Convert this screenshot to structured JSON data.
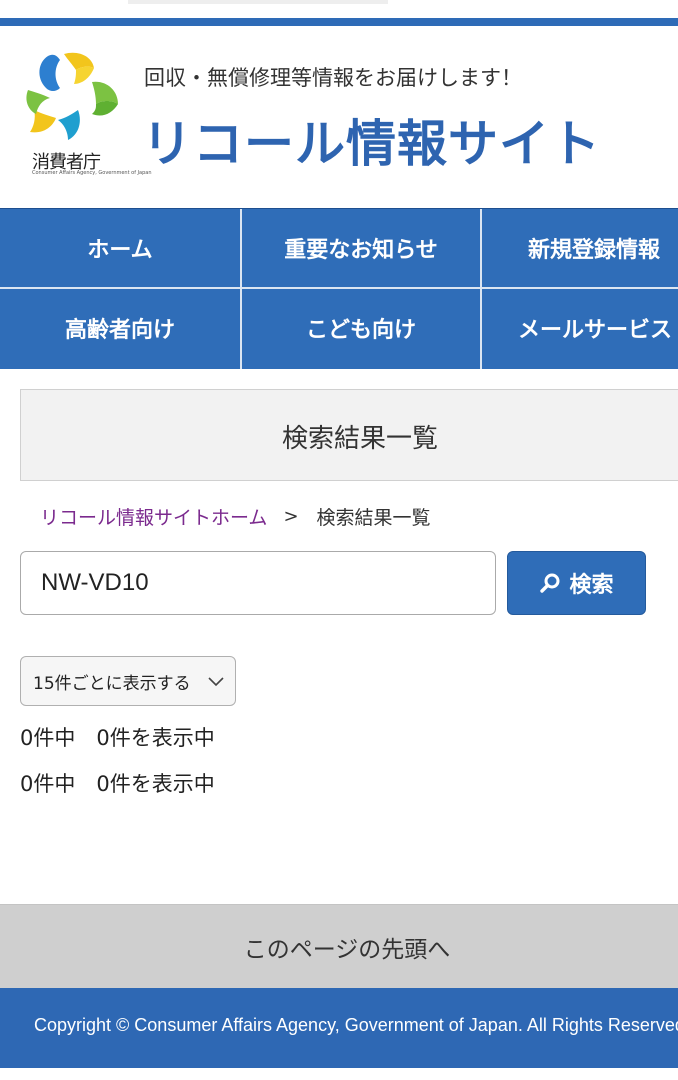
{
  "header": {
    "logo_caption": "消費者庁",
    "logo_sub": "Consumer Affairs Agency, Government of Japan",
    "tagline": "回収・無償修理等情報をお届けします！",
    "site_title": "リコール情報サイト"
  },
  "nav": {
    "items": [
      {
        "label": "ホーム"
      },
      {
        "label": "重要なお知らせ"
      },
      {
        "label": "新規登録情報"
      },
      {
        "label": "高齢者向け"
      },
      {
        "label": "こども向け"
      },
      {
        "label": "メールサービス"
      }
    ]
  },
  "page": {
    "heading": "検索結果一覧"
  },
  "breadcrumb": {
    "home": "リコール情報サイトホーム",
    "separator": ">",
    "current": "検索結果一覧"
  },
  "search": {
    "value": "NW-VD10",
    "button_label": "検索"
  },
  "results": {
    "per_page": "15件ごとに表示する",
    "count_top": "0件中　0件を表示中",
    "count_bottom": "0件中　0件を表示中"
  },
  "footer": {
    "back_to_top": "このページの先頭へ",
    "copyright": "Copyright © Consumer Affairs Agency, Government of Japan. All Rights Reserved."
  },
  "colors": {
    "primary": "#2f6db8",
    "title_blue": "#2e64b0",
    "link_purple": "#7b2a8e"
  }
}
